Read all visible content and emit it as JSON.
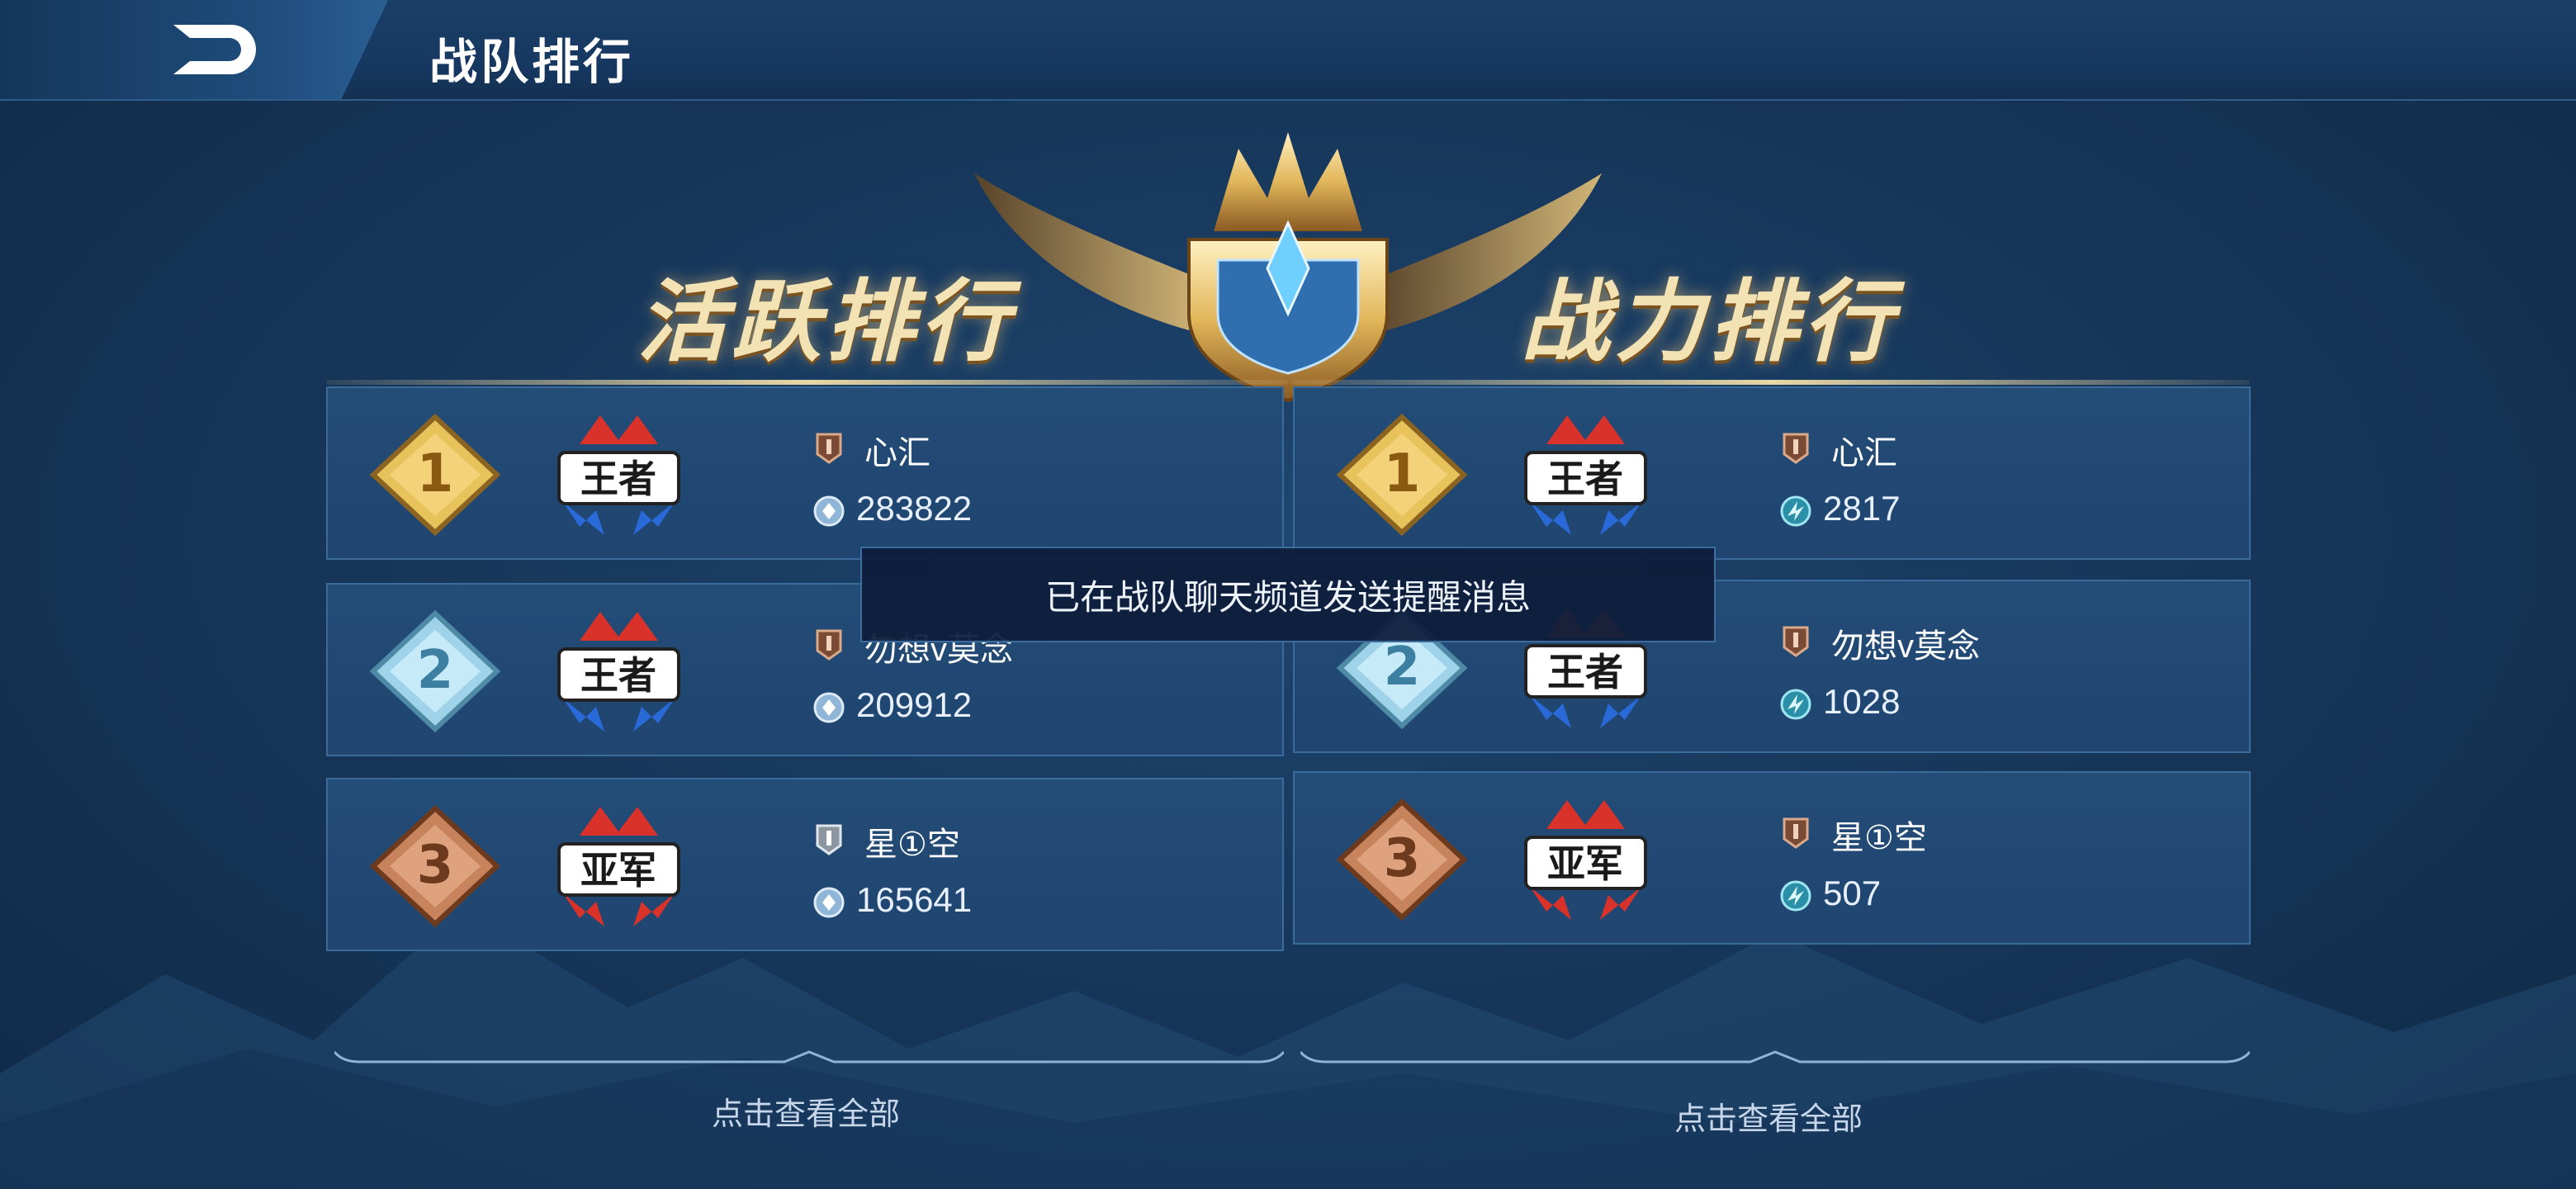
{
  "header": {
    "title": "战队排行"
  },
  "headings": {
    "activity": "活跃排行",
    "power": "战力排行"
  },
  "activity_ranking": {
    "entries": [
      {
        "rank": "1",
        "tier": "王者",
        "name": "心汇",
        "score": "283822"
      },
      {
        "rank": "2",
        "tier": "王者",
        "name": "勿想v莫念",
        "score": "209912"
      },
      {
        "rank": "3",
        "tier": "亚军",
        "name": "星①空",
        "score": "165641"
      }
    ],
    "view_all": "点击查看全部"
  },
  "power_ranking": {
    "entries": [
      {
        "rank": "1",
        "tier": "王者",
        "name": "心汇",
        "score": "2817"
      },
      {
        "rank": "2",
        "tier": "王者",
        "name": "勿想v莫念",
        "score": "1028"
      },
      {
        "rank": "3",
        "tier": "亚军",
        "name": "星①空",
        "score": "507"
      }
    ],
    "view_all": "点击查看全部"
  },
  "toast": {
    "message": "已在战队聊天频道发送提醒消息"
  },
  "colors": {
    "background": "#17375b",
    "card": "#234c77",
    "gold": "#e8c35c",
    "silver": "#9fd3ea",
    "bronze": "#c7835c",
    "tier_red": "#d8322a",
    "tier_blue": "#2a6ad8"
  },
  "icons": {
    "back": "back-arrow-icon",
    "rank_badge": "diamond-rank-badge-icon",
    "tier_emblem": "crown-tier-emblem-icon",
    "name_marker": "team-rank-flag-icon",
    "activity_score": "activity-icon",
    "power_score": "power-icon"
  }
}
